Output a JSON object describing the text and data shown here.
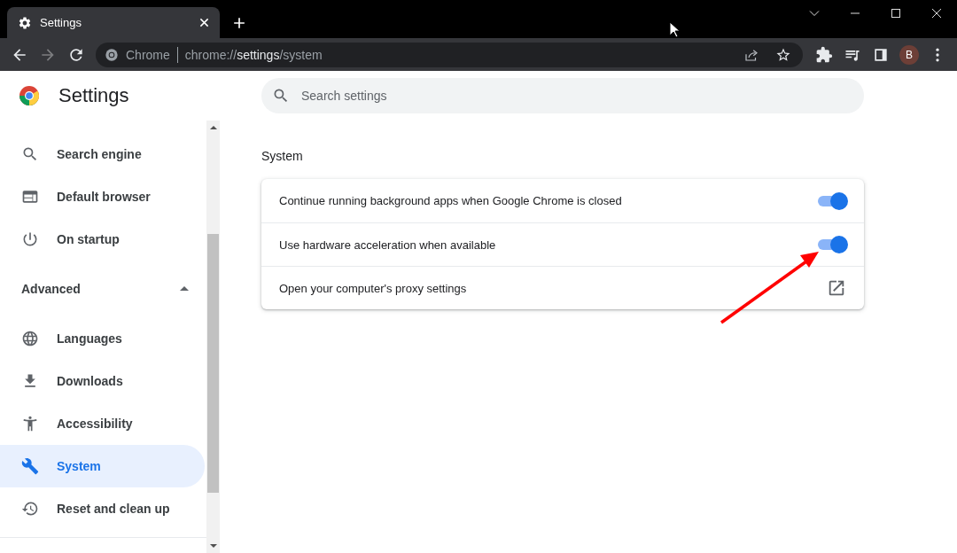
{
  "browser": {
    "tab": {
      "title": "Settings",
      "selected": true
    },
    "omnibox": {
      "site_label": "Chrome",
      "url_scheme": "chrome://",
      "url_host": "settings",
      "url_path": "/system"
    },
    "profile_initial": "B"
  },
  "sidebar": {
    "title": "Settings",
    "items": [
      {
        "label": "Search engine",
        "selected": false
      },
      {
        "label": "Default browser",
        "selected": false
      },
      {
        "label": "On startup",
        "selected": false
      }
    ],
    "sections": [
      {
        "label": "Advanced",
        "expanded": true,
        "items": [
          {
            "label": "Languages",
            "selected": false
          },
          {
            "label": "Downloads",
            "selected": false
          },
          {
            "label": "Accessibility",
            "selected": false
          },
          {
            "label": "System",
            "selected": true
          },
          {
            "label": "Reset and clean up",
            "selected": false
          }
        ]
      }
    ]
  },
  "search": {
    "placeholder": "Search settings"
  },
  "section": {
    "title": "System",
    "rows": [
      {
        "kind": "toggle",
        "label": "Continue running background apps when Google Chrome is closed",
        "on": true
      },
      {
        "kind": "toggle",
        "label": "Use hardware acceleration when available",
        "on": true
      },
      {
        "kind": "link",
        "label": "Open your computer's proxy settings"
      }
    ]
  }
}
